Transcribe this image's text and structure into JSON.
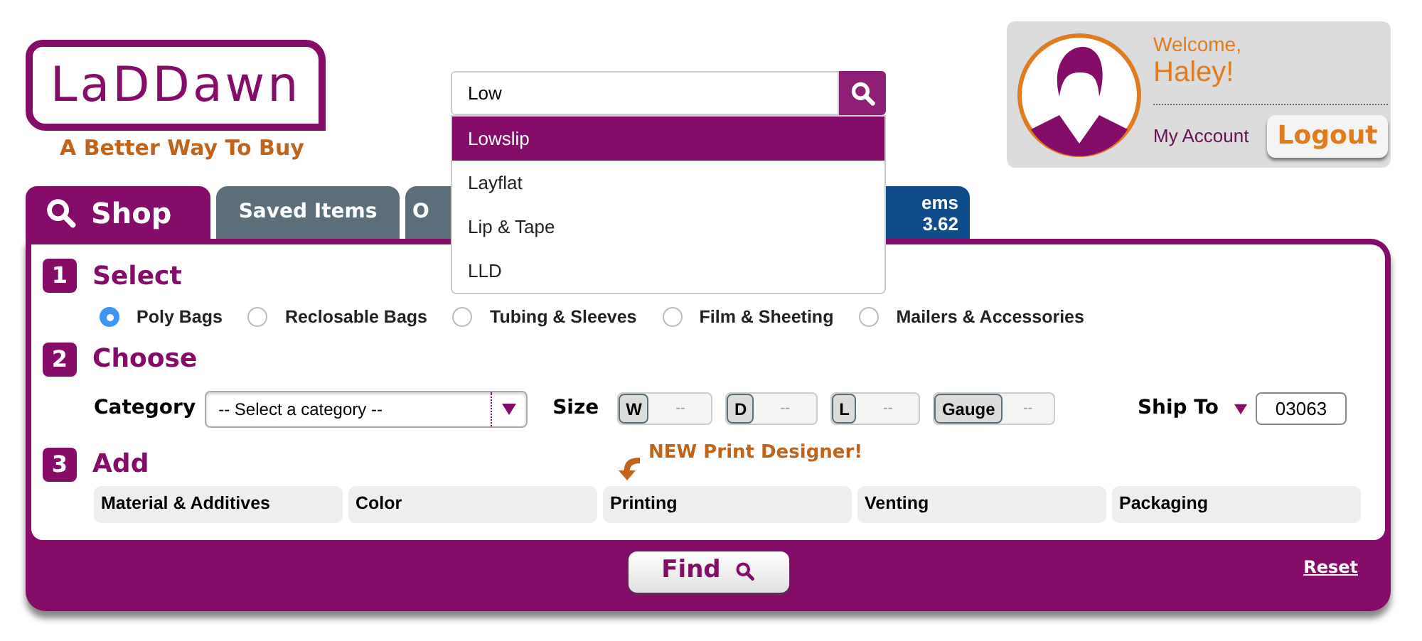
{
  "logo": {
    "text": "LaDDawn",
    "tagline": "A Better Way To Buy"
  },
  "search": {
    "value": "Low",
    "suggestions": [
      {
        "label": "Lowslip",
        "selected": true
      },
      {
        "label": "Layflat",
        "selected": false
      },
      {
        "label": "Lip & Tape",
        "selected": false
      },
      {
        "label": "LLD",
        "selected": false
      }
    ]
  },
  "user": {
    "welcome": "Welcome,",
    "name": "Haley!",
    "account_link": "My Account",
    "logout": "Logout"
  },
  "tabs": [
    {
      "kind": "main",
      "label": "Shop",
      "selected": true
    },
    {
      "kind": "plain",
      "label": "Saved Items",
      "selected": false
    },
    {
      "kind": "plain",
      "label": "O",
      "selected": false
    },
    {
      "kind": "cart",
      "label": "ems",
      "detail": "3.62",
      "selected": false
    }
  ],
  "select_step": {
    "number": "1",
    "title": "Select",
    "options": [
      {
        "label": "Poly Bags",
        "selected": true
      },
      {
        "label": "Reclosable Bags",
        "selected": false
      },
      {
        "label": "Tubing & Sleeves",
        "selected": false
      },
      {
        "label": "Film & Sheeting",
        "selected": false
      },
      {
        "label": "Mailers & Accessories",
        "selected": false
      }
    ]
  },
  "choose_step": {
    "number": "2",
    "title": "Choose",
    "category": {
      "label": "Category",
      "value": "-- Select a category --"
    },
    "size": {
      "label": "Size",
      "fields": [
        {
          "label": "W",
          "placeholder": "--"
        },
        {
          "label": "D",
          "placeholder": "--"
        },
        {
          "label": "L",
          "placeholder": "--"
        },
        {
          "label": "Gauge",
          "placeholder": "--"
        }
      ]
    },
    "ship_to": {
      "label": "Ship To",
      "value": "03063"
    }
  },
  "add_step": {
    "number": "3",
    "title": "Add",
    "promo": "NEW Print Designer!",
    "options": [
      "Material & Additives",
      "Color",
      "Printing",
      "Venting",
      "Packaging"
    ]
  },
  "find_button": "Find",
  "reset_link": "Reset"
}
